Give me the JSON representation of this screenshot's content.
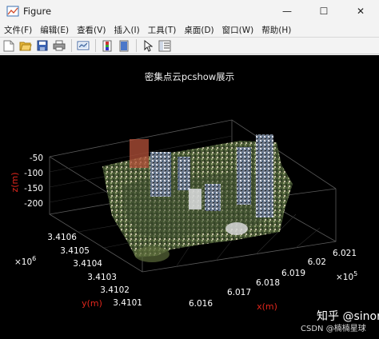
{
  "window": {
    "title": "Figure",
    "controls": {
      "minimize": "—",
      "maximize": "☐",
      "close": "✕"
    }
  },
  "menu": [
    "文件(F)",
    "编辑(E)",
    "查看(V)",
    "插入(I)",
    "工具(T)",
    "桌面(D)",
    "窗口(W)",
    "帮助(H)"
  ],
  "toolbar": {
    "icons": [
      "new-figure-icon",
      "open-file-icon",
      "save-icon",
      "print-icon",
      "link-plot-icon",
      "colorbar-icon",
      "legend-icon",
      "pointer-icon",
      "property-inspector-icon"
    ]
  },
  "plot": {
    "title": "密集点云pcshow展示",
    "z_label": "z(m)",
    "y_label": "y(m)",
    "x_label": "x(m)",
    "z_ticks": [
      "-50",
      "-100",
      "-150",
      "-200"
    ],
    "y_ticks": [
      "3.4106",
      "3.4105",
      "3.4104",
      "3.4103",
      "3.4102",
      "3.4101"
    ],
    "y_exponent_base": "×10",
    "y_exponent_power": "6",
    "x_ticks": [
      "6.016",
      "6.017",
      "6.018",
      "6.019",
      "6.02",
      "6.021"
    ],
    "x_exponent_base": "×10",
    "x_exponent_power": "5",
    "colors": {
      "background": "#000000",
      "axis_label": "#e0261c",
      "tick_text": "#ffffff"
    }
  },
  "watermark": {
    "main": "知乎 @sinor",
    "sub": "CSDN @楠楠星球"
  }
}
